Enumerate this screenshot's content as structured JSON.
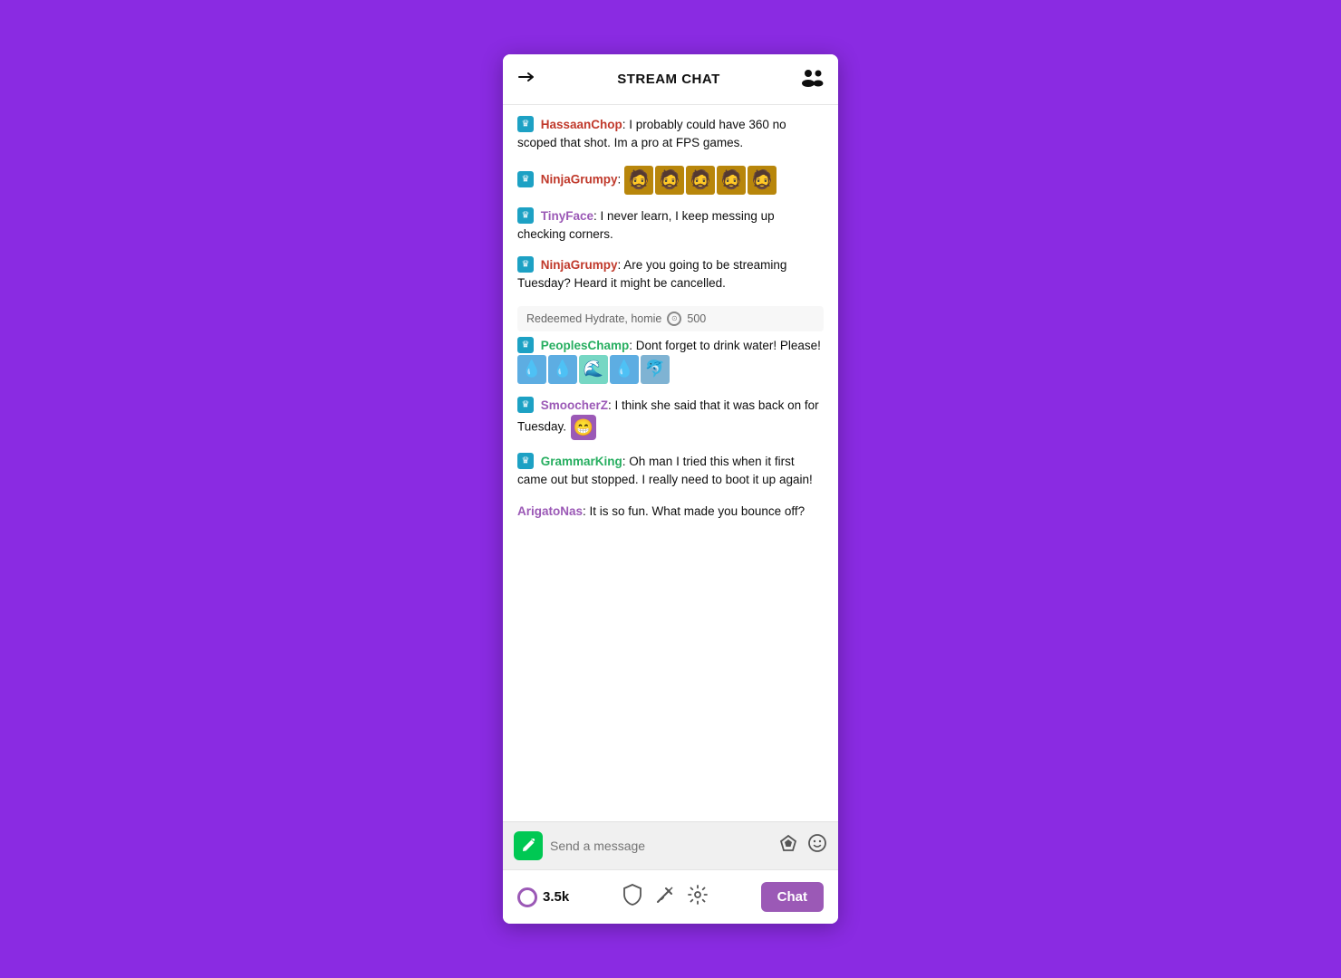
{
  "header": {
    "title": "STREAM CHAT",
    "collapse_label": "collapse",
    "users_label": "users"
  },
  "messages": [
    {
      "id": "msg1",
      "badge": true,
      "username": "HassaanChop",
      "username_color": "red",
      "text": ": I probably could have 360 no scoped that shot. Im a pro at FPS games.",
      "has_emotes": false
    },
    {
      "id": "msg2",
      "badge": true,
      "username": "NinjaGrumpy",
      "username_color": "red",
      "text": ":",
      "has_emotes": "faces"
    },
    {
      "id": "msg3",
      "badge": true,
      "username": "TinyFace",
      "username_color": "purple",
      "text": ": I never learn, I keep messing up checking corners.",
      "has_emotes": false
    },
    {
      "id": "msg4",
      "badge": true,
      "username": "NinjaGrumpy",
      "username_color": "red",
      "text": ": Are you going to be streaming Tuesday? Heard it might be cancelled.",
      "has_emotes": false
    }
  ],
  "redeemed": {
    "text": "Redeemed Hydrate, homie",
    "points": "500"
  },
  "messages2": [
    {
      "id": "msg5",
      "badge": true,
      "username": "PeoplesChamp",
      "username_color": "green",
      "text": ": Dont forget to drink water! Please!",
      "has_emotes": "water"
    },
    {
      "id": "msg6",
      "badge": true,
      "username": "SmoocherZ",
      "username_color": "purple",
      "text": ": I think she said that it was back on for Tuesday.",
      "has_emotes": "smile"
    },
    {
      "id": "msg7",
      "badge": true,
      "username": "GrammarKing",
      "username_color": "green",
      "text": ": Oh man I tried this when it first came out but stopped. I really need to boot it up again!",
      "has_emotes": false
    },
    {
      "id": "msg8",
      "badge": false,
      "username": "ArigatoNas",
      "username_color": "purple",
      "text": ": It is so fun. What made you bounce off?",
      "has_emotes": false
    }
  ],
  "input": {
    "placeholder": "Send a message"
  },
  "footer": {
    "viewer_count": "3.5k",
    "chat_button_label": "Chat"
  }
}
